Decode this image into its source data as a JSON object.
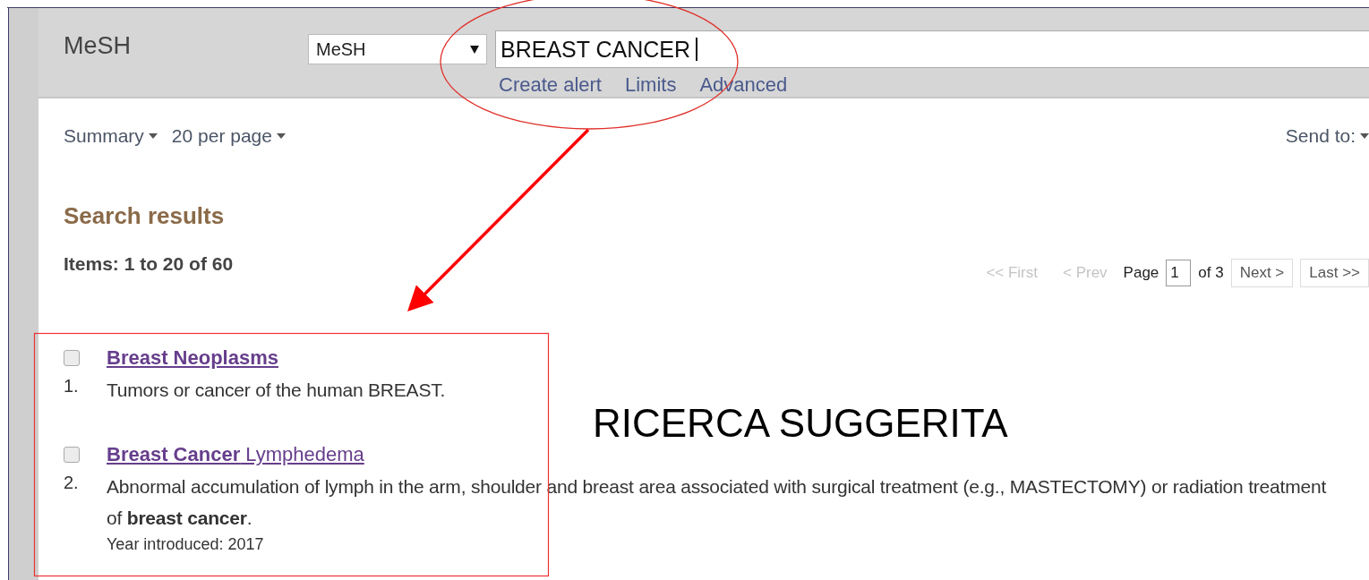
{
  "header": {
    "title": "MeSH",
    "database": "MeSH",
    "query": "BREAST CANCER",
    "links": [
      "Create alert",
      "Limits",
      "Advanced"
    ]
  },
  "toolbar": {
    "format": "Summary",
    "per_page": "20 per page",
    "send_to": "Send to:"
  },
  "results": {
    "heading": "Search results",
    "count": "Items: 1 to 20 of 60"
  },
  "pager": {
    "before": [
      {
        "label": "<< First",
        "disabled": true
      },
      {
        "label": "< Prev",
        "disabled": true
      }
    ],
    "page_label": "Page",
    "page_value": "1",
    "of_label": "of 3",
    "after": [
      {
        "label": "Next >",
        "disabled": false
      },
      {
        "label": "Last >>",
        "disabled": false
      }
    ]
  },
  "items": [
    {
      "number": "1.",
      "checked": false,
      "title": "Breast Neoplasms",
      "description": "Tumors or cancer of the human BREAST."
    },
    {
      "number": "2.",
      "checked": false,
      "title": "**Breast Cancer** Lymphedema",
      "description": "Abnormal accumulation of lymph in the arm, shoulder and breast area associated with surgical treatment (e.g., MASTECTOMY) or radiation treatment of **breast cancer**.",
      "note": "Year introduced: 2017"
    }
  ],
  "annotation": {
    "label": "RICERCA SUGGERITA"
  }
}
